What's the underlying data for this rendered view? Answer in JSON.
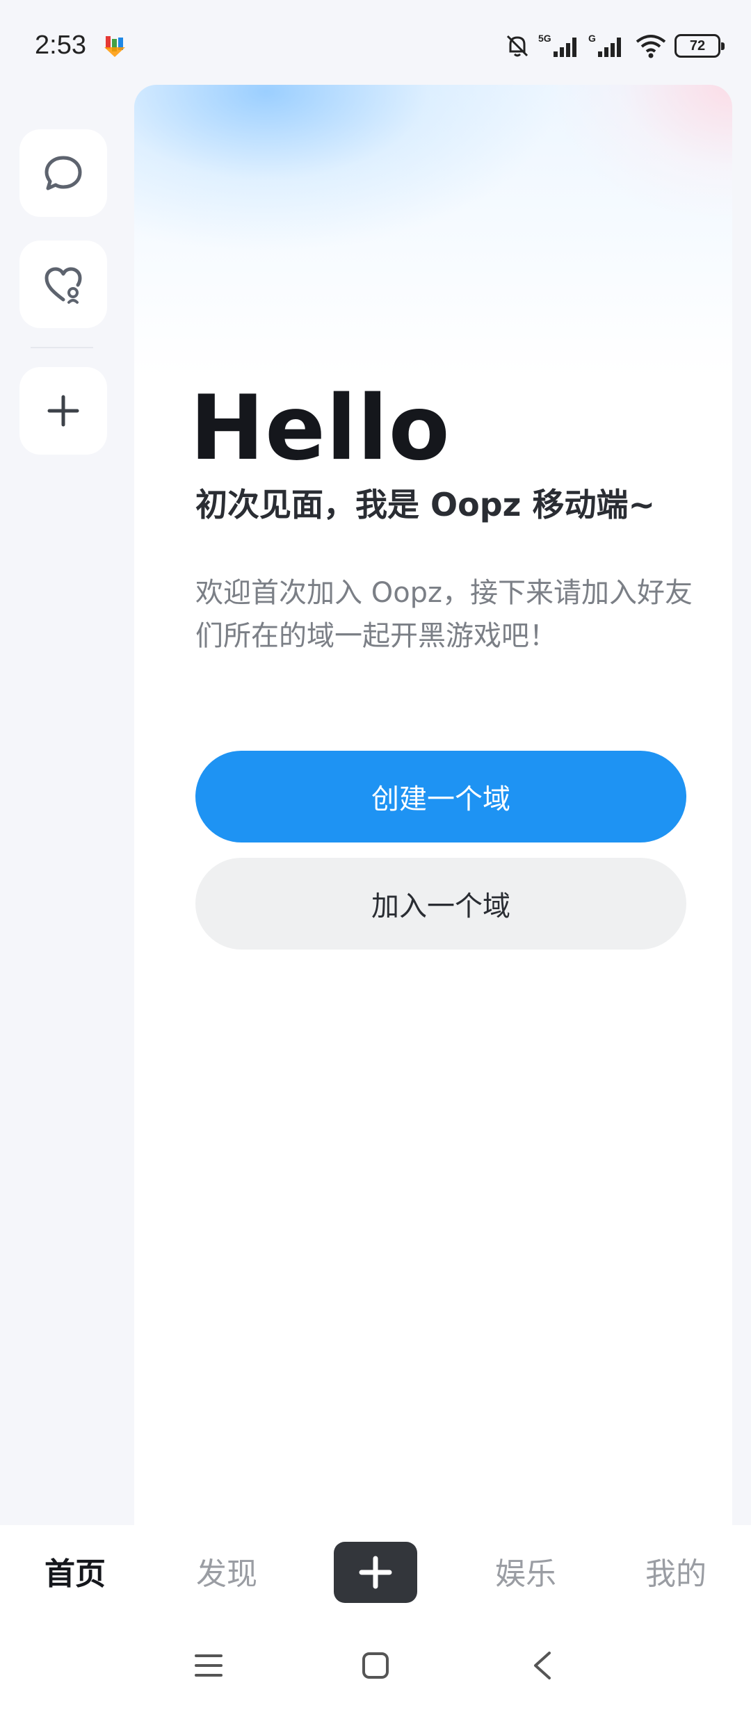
{
  "status_bar": {
    "time": "2:53",
    "network_1": "5G",
    "network_2": "G",
    "battery": "72"
  },
  "rail": {
    "items": [
      {
        "icon": "chat-bubble-icon"
      },
      {
        "icon": "heart-location-icon"
      },
      {
        "icon": "plus-icon"
      }
    ]
  },
  "welcome": {
    "greeting": "Hello",
    "subtitle": "初次见面，我是 Oopz 移动端~",
    "description": "欢迎首次加入 Oopz，接下来请加入好友们所在的域一起开黑游戏吧！",
    "create_label": "创建一个域",
    "join_label": "加入一个域"
  },
  "tabbar": {
    "home": "首页",
    "discover": "发现",
    "entertainment": "娱乐",
    "mine": "我的"
  },
  "colors": {
    "primary": "#1e93f3",
    "secondary_bg": "#eff0f1",
    "plus_bg": "#33363b"
  }
}
